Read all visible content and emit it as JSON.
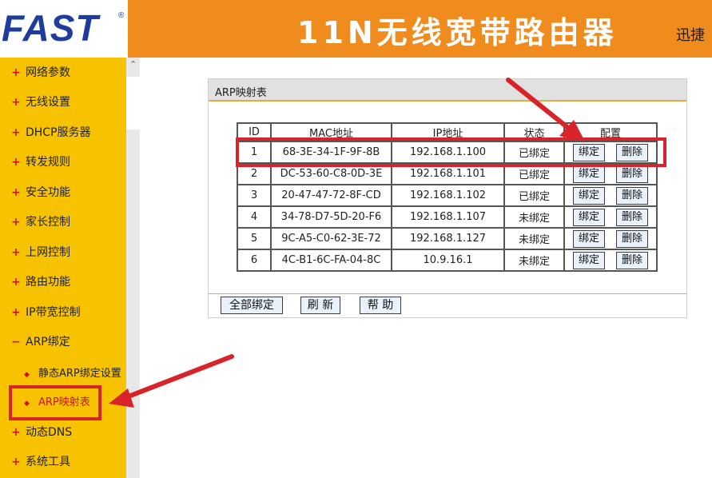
{
  "header": {
    "logo": "FAST",
    "logo_mark": "®",
    "title": "11N无线宽带路由器",
    "extra": "迅捷"
  },
  "sidebar": {
    "items": [
      {
        "label": "网络参数"
      },
      {
        "label": "无线设置"
      },
      {
        "label": "DHCP服务器"
      },
      {
        "label": "转发规则"
      },
      {
        "label": "安全功能"
      },
      {
        "label": "家长控制"
      },
      {
        "label": "上网控制"
      },
      {
        "label": "路由功能"
      },
      {
        "label": "IP带宽控制"
      },
      {
        "label": "ARP绑定"
      },
      {
        "label": "动态DNS"
      },
      {
        "label": "系统工具"
      }
    ],
    "sub_items": [
      {
        "label": "静态ARP绑定设置"
      },
      {
        "label": "ARP映射表"
      }
    ],
    "active_sub": "ARP映射表"
  },
  "panel": {
    "title": "ARP映射表",
    "columns": [
      "ID",
      "MAC地址",
      "IP地址",
      "状态",
      "配置"
    ],
    "rows": [
      {
        "id": "1",
        "mac": "68-3E-34-1F-9F-8B",
        "ip": "192.168.1.100",
        "status": "已绑定"
      },
      {
        "id": "2",
        "mac": "DC-53-60-C8-0D-3E",
        "ip": "192.168.1.101",
        "status": "已绑定"
      },
      {
        "id": "3",
        "mac": "20-47-47-72-8F-CD",
        "ip": "192.168.1.102",
        "status": "已绑定"
      },
      {
        "id": "4",
        "mac": "34-78-D7-5D-20-F6",
        "ip": "192.168.1.107",
        "status": "未绑定"
      },
      {
        "id": "5",
        "mac": "9C-A5-C0-62-3E-72",
        "ip": "192.168.1.127",
        "status": "未绑定"
      },
      {
        "id": "6",
        "mac": "4C-B1-6C-FA-04-8C",
        "ip": "10.9.16.1",
        "status": "未绑定"
      }
    ],
    "bind_label": "绑定",
    "delete_label": "删除",
    "buttons": {
      "bind_all": "全部绑定",
      "refresh": "刷 新",
      "help": "帮 助"
    }
  },
  "colors": {
    "header_orange": "#f08c1e",
    "sidebar_yellow": "#f7c300",
    "annotation_red": "#d9232a",
    "bullet_red": "#d0101a"
  }
}
